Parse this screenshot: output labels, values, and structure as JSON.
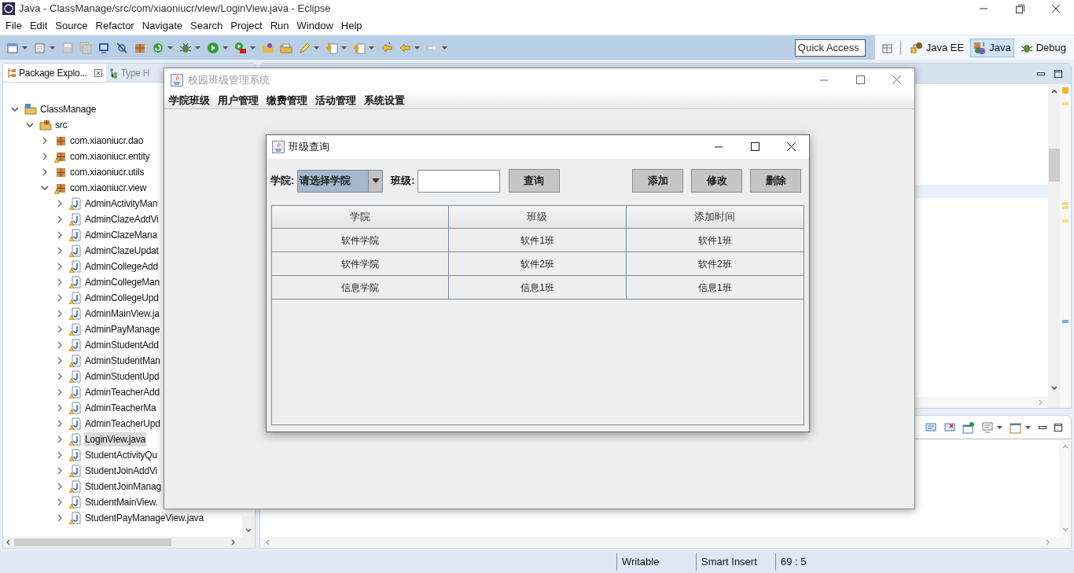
{
  "eclipse": {
    "title": "Java - ClassManage/src/com/xiaoniucr/view/LoginView.java - Eclipse",
    "menu": [
      "File",
      "Edit",
      "Source",
      "Refactor",
      "Navigate",
      "Search",
      "Project",
      "Run",
      "Window",
      "Help"
    ],
    "quick_access": {
      "placeholder": "Quick Access"
    },
    "perspectives": [
      {
        "label": "Java EE",
        "selected": false
      },
      {
        "label": "Java",
        "selected": true
      },
      {
        "label": "Debug",
        "selected": false
      }
    ],
    "explorer_tabs": [
      {
        "label": "Package Explo...",
        "selected": true
      },
      {
        "label": "Type H",
        "selected": false
      }
    ],
    "tree": [
      {
        "label": "ClassManage",
        "kind": "project",
        "expanded": true,
        "selected": false,
        "warning": false,
        "children": [
          {
            "label": "src",
            "kind": "folder",
            "expanded": true,
            "selected": false,
            "warning": false,
            "children": [
              {
                "label": "com.xiaoniucr.dao",
                "kind": "package",
                "expanded": false,
                "selected": false,
                "warning": false
              },
              {
                "label": "com.xiaoniucr.entity",
                "kind": "package",
                "expanded": false,
                "selected": false,
                "warning": true
              },
              {
                "label": "com.xiaoniucr.utils",
                "kind": "package",
                "expanded": false,
                "selected": false,
                "warning": false
              },
              {
                "label": "com.xiaoniucr.view",
                "kind": "package",
                "expanded": true,
                "selected": false,
                "warning": true,
                "children": [
                  {
                    "label": "AdminActivityMan",
                    "kind": "file",
                    "expanded": false,
                    "selected": false,
                    "warning": true
                  },
                  {
                    "label": "AdminClazeAddVi",
                    "kind": "file",
                    "expanded": false,
                    "selected": false,
                    "warning": true
                  },
                  {
                    "label": "AdminClazeMana",
                    "kind": "file",
                    "expanded": false,
                    "selected": false,
                    "warning": true
                  },
                  {
                    "label": "AdminClazeUpdat",
                    "kind": "file",
                    "expanded": false,
                    "selected": false,
                    "warning": true
                  },
                  {
                    "label": "AdminCollegeAdd",
                    "kind": "file",
                    "expanded": false,
                    "selected": false,
                    "warning": true
                  },
                  {
                    "label": "AdminCollegeMan",
                    "kind": "file",
                    "expanded": false,
                    "selected": false,
                    "warning": true
                  },
                  {
                    "label": "AdminCollegeUpd",
                    "kind": "file",
                    "expanded": false,
                    "selected": false,
                    "warning": true
                  },
                  {
                    "label": "AdminMainView.ja",
                    "kind": "file",
                    "expanded": false,
                    "selected": false,
                    "warning": true
                  },
                  {
                    "label": "AdminPayManage",
                    "kind": "file",
                    "expanded": false,
                    "selected": false,
                    "warning": true
                  },
                  {
                    "label": "AdminStudentAdd",
                    "kind": "file",
                    "expanded": false,
                    "selected": false,
                    "warning": true
                  },
                  {
                    "label": "AdminStudentMan",
                    "kind": "file",
                    "expanded": false,
                    "selected": false,
                    "warning": true
                  },
                  {
                    "label": "AdminStudentUpd",
                    "kind": "file",
                    "expanded": false,
                    "selected": false,
                    "warning": true
                  },
                  {
                    "label": "AdminTeacherAdd",
                    "kind": "file",
                    "expanded": false,
                    "selected": false,
                    "warning": true
                  },
                  {
                    "label": "AdminTeacherMa",
                    "kind": "file",
                    "expanded": false,
                    "selected": false,
                    "warning": true
                  },
                  {
                    "label": "AdminTeacherUpd",
                    "kind": "file",
                    "expanded": false,
                    "selected": false,
                    "warning": true
                  },
                  {
                    "label": "LoginView.java",
                    "kind": "file",
                    "expanded": false,
                    "selected": true,
                    "warning": true
                  },
                  {
                    "label": "StudentActivityQu",
                    "kind": "file",
                    "expanded": false,
                    "selected": false,
                    "warning": true
                  },
                  {
                    "label": "StudentJoinAddVi",
                    "kind": "file",
                    "expanded": false,
                    "selected": false,
                    "warning": true
                  },
                  {
                    "label": "StudentJoinManag",
                    "kind": "file",
                    "expanded": false,
                    "selected": false,
                    "warning": true
                  },
                  {
                    "label": "StudentMainView.",
                    "kind": "file",
                    "expanded": false,
                    "selected": false,
                    "warning": true
                  },
                  {
                    "label": "StudentPayManageView.java",
                    "kind": "file",
                    "expanded": false,
                    "selected": false,
                    "warning": true
                  }
                ]
              }
            ]
          }
        ]
      }
    ],
    "status_bar": [
      "Writable",
      "Smart Insert",
      "69 : 5"
    ]
  },
  "main_window": {
    "title": "校园班级管理系统",
    "active": false,
    "menu": [
      "学院班级",
      "用户管理",
      "缴费管理",
      "活动管理",
      "系统设置"
    ]
  },
  "dialog": {
    "title": "班级查询",
    "college_label": "学院:",
    "college_combo": "请选择学院",
    "class_label": "班级:",
    "query_button": "查询",
    "buttons": [
      "添加",
      "修改",
      "删除"
    ],
    "table": {
      "columns": [
        "学院",
        "班级",
        "添加时间"
      ],
      "rows": [
        [
          "软件学院",
          "软件1班",
          "软件1班"
        ],
        [
          "软件学院",
          "软件2班",
          "软件2班"
        ],
        [
          "信息学院",
          "信息1班",
          "信息1班"
        ]
      ]
    }
  }
}
